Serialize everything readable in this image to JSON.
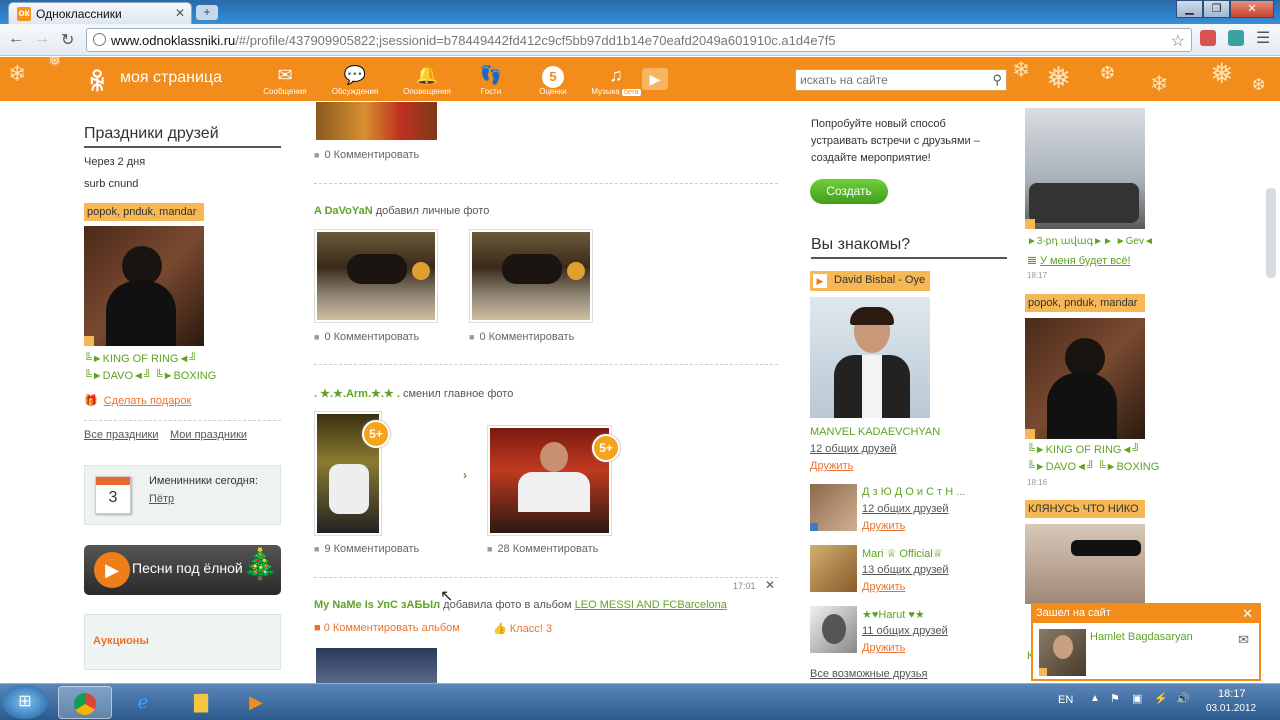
{
  "browser": {
    "tab_title": "Одноклассники",
    "tab_favicon": "ok",
    "url_host": "www.odnoklassniki.ru",
    "url_rest": "/#/profile/437909905822;jsessionid=b78449442fd412c9cf5bb97dd1b14e70eafd2049a601910c.a1d4e7f5"
  },
  "header": {
    "my_page": "моя страница",
    "menu": [
      {
        "label": "Сообщения",
        "icon": "envelope-icon"
      },
      {
        "label": "Обсуждения",
        "icon": "speech-bubbles-icon"
      },
      {
        "label": "Оповещения",
        "icon": "bell-icon"
      },
      {
        "label": "Гости",
        "icon": "footprints-icon"
      },
      {
        "label": "Оценки",
        "icon": "five-badge-icon",
        "badge": "5"
      },
      {
        "label": "Музыка",
        "icon": "music-note-icon",
        "beta": "бета"
      }
    ],
    "search_placeholder": "искать на сайте",
    "colors": {
      "brand": "#f28c1a",
      "green_text": "#5fa323",
      "link_orange": "#eb722e"
    }
  },
  "left": {
    "holidays_title": "Праздники друзей",
    "in_days": "Через 2 дня",
    "holiday_name": "surb cnund",
    "friend_caption": "popok, pnduk, mandar",
    "friend_line1": "╚►KING OF RING◄╝",
    "friend_line2a": "╚►DAVO◄╝",
    "friend_line2b": "╚►BOXING",
    "gift": "Сделать подарок",
    "all_holidays": "Все праздники",
    "my_holidays": "Мои праздники",
    "birthdays_label": "Именинники сегодня:",
    "birthday_day": "3",
    "birthday_name": "Пётр",
    "songs": "Песни под ёлной",
    "auctions": "Аукционы"
  },
  "feed": {
    "item0_comment": "0 Комментировать",
    "item1_author": "A DaVoYaN",
    "item1_action": "добавил личные фото",
    "item1_c1": "0 Комментировать",
    "item1_c2": "0 Комментировать",
    "item2_author": ". ★.★.Arm.★.★ .",
    "item2_action": "сменил главное фото",
    "item2_badge1": "5+",
    "item2_badge2": "5+",
    "item2_c1": "9 Комментировать",
    "item2_c2": "28 Комментировать",
    "item3_time": "17:01",
    "item3_author": "My NaMe Is УпС зАБЫл",
    "item3_action": "добавила фото в альбом",
    "item3_album": "LEO MESSI AND FCBarcelona",
    "item3_comment": "0 Комментировать альбом",
    "item3_like": "Класс! 3"
  },
  "right": {
    "event_text": "Попробуйте новый способ устраивать встречи с друзьями – создайте мероприятие!",
    "create": "Создать",
    "know_title": "Вы знакомы?",
    "music_caption": "David Bisbal - Oye",
    "p1_name": "MANVEL KADAEVCHYAN",
    "p1_common": "12 общих друзей",
    "add_friend": "Дружить",
    "people": [
      {
        "name": "Д з Ю Д О и С т Н ...",
        "common": "12 общих друзей",
        "add": "Дружить"
      },
      {
        "name": "Mari ♕ Official♕",
        "common": "13 общих друзей",
        "add": "Дружить"
      },
      {
        "name": "★♥Harut ♥★",
        "common": "11 общих друзей",
        "add": "Дружить"
      }
    ],
    "all_friends": "Все возможные друзья"
  },
  "far_right": {
    "a_name": "►3-рդ ավագ►► ►Gev◄",
    "a_status": "У меня будет всё!",
    "a_time": "18:17",
    "b_caption": "popok, pnduk, mandar",
    "b_line1": "╚►KING OF RING◄╝",
    "b_line2a": "╚►DAVO◄╝",
    "b_line2b": "╚►BOXING",
    "b_time": "18:16",
    "c_caption": "КЛЯНУСЬ ЧТО НИКО",
    "c_letter": "К"
  },
  "popup": {
    "title": "Зашел на сайт",
    "name": "Hamlet Bagdasaryan"
  },
  "taskbar": {
    "lang": "EN",
    "time": "18:17",
    "date": "03.01.2012"
  }
}
